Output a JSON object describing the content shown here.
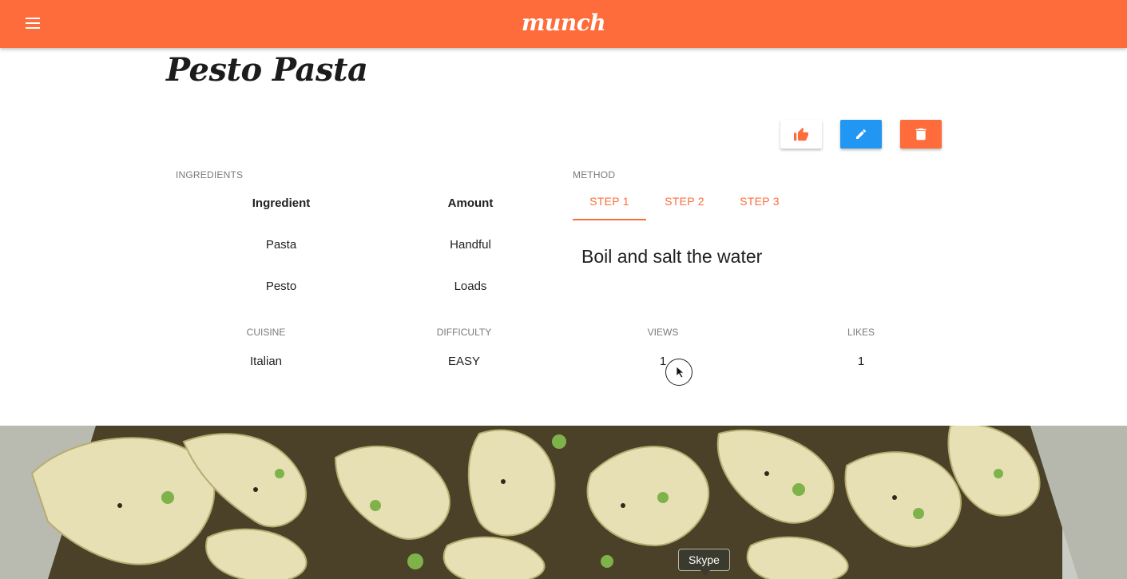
{
  "app": {
    "brand": "munch"
  },
  "recipe": {
    "title": "Pesto Pasta"
  },
  "actions": {
    "like_icon": "thumb-up-icon",
    "edit_icon": "pencil-icon",
    "delete_icon": "trash-icon"
  },
  "ingredients": {
    "caption": "INGREDIENTS",
    "headers": {
      "ingredient": "Ingredient",
      "amount": "Amount"
    },
    "rows": [
      {
        "ingredient": "Pasta",
        "amount": "Handful"
      },
      {
        "ingredient": "Pesto",
        "amount": "Loads"
      }
    ]
  },
  "method": {
    "caption": "METHOD",
    "tabs": [
      {
        "label": "STEP 1",
        "active": true
      },
      {
        "label": "STEP 2",
        "active": false
      },
      {
        "label": "STEP 3",
        "active": false
      }
    ],
    "current_step_text": "Boil and salt the water"
  },
  "stats": [
    {
      "label": "CUISINE",
      "value": "Italian"
    },
    {
      "label": "DIFFICULTY",
      "value": "EASY"
    },
    {
      "label": "VIEWS",
      "value": "1"
    },
    {
      "label": "LIKES",
      "value": "1"
    }
  ],
  "tooltip": {
    "text": "Skype"
  },
  "colors": {
    "primary": "#ff6c3b",
    "edit": "#2196f3",
    "text": "#212121",
    "caption": "#7a7a7a"
  }
}
